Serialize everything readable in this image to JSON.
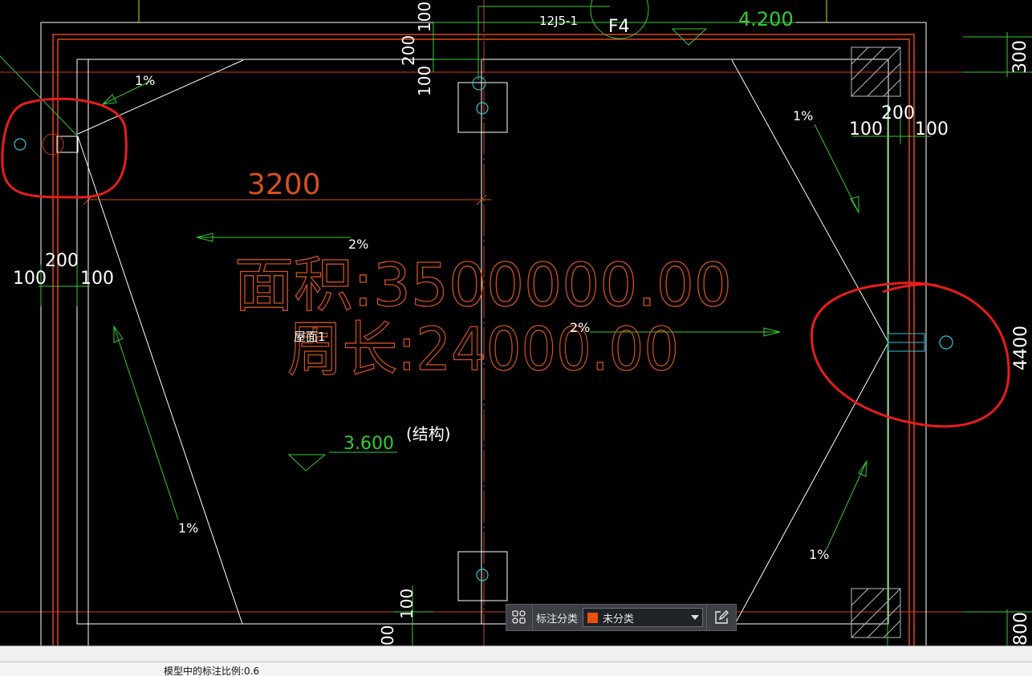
{
  "drawing": {
    "top_label_1": "12J5-1",
    "top_label_2": "F4",
    "elevation_top": "4.200",
    "dim_100_a": "100",
    "dim_200_a": "200",
    "dim_100_b": "100",
    "dim_300_right": "300",
    "dim_200_right": "200",
    "dim_100_right_l": "100",
    "dim_100_right_r": "100",
    "dim_3200": "3200",
    "dim_200_left": "200",
    "dim_100_left_l": "100",
    "dim_100_left_r": "100",
    "dim_4400": "4400",
    "dim_100_bottom": "100",
    "dim_00_bottom": "00",
    "dim_800_right": "800",
    "area_text": "面积:3500000.00",
    "perimeter_text": "周长:24000.00",
    "roof_label": "屋面1",
    "slope_1_tl": "1%",
    "slope_1_tr": "1%",
    "slope_2_left": "2%",
    "slope_2_right": "2%",
    "slope_1_bl": "1%",
    "slope_1_br": "1%",
    "elevation_struct": "3.600",
    "elevation_struct_note": "(结构)"
  },
  "toolbar": {
    "label": "标注分类",
    "selected": "未分类",
    "selected_color": "#e8500c"
  },
  "status": {
    "text": "模型中的标注比例:0.6"
  },
  "icons": [
    "layers-grid-icon",
    "chevron-down-icon",
    "edit-icon"
  ]
}
